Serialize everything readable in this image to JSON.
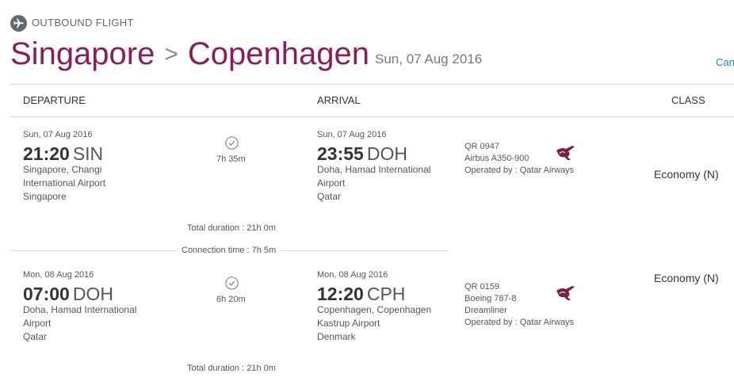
{
  "header": {
    "section_label": "OUTBOUND FLIGHT",
    "origin": "Singapore",
    "separator": ">",
    "destination": "Copenhagen",
    "date": "Sun, 07 Aug 2016",
    "cancel_link": "Canc"
  },
  "columns": {
    "departure": "DEPARTURE",
    "arrival": "ARRIVAL",
    "class": "CLASS"
  },
  "segments": [
    {
      "dep_date": "Sun, 07 Aug 2016",
      "dep_time": "21:20",
      "dep_code": "SIN",
      "dep_place": [
        "Singapore, Changi",
        "International Airport",
        "Singapore"
      ],
      "duration": "7h 35m",
      "arr_date": "Sun, 07 Aug 2016",
      "arr_time": "23:55",
      "arr_code": "DOH",
      "arr_place": [
        "Doha, Hamad International",
        "Airport",
        "Qatar"
      ],
      "flight_lines": [
        "QR 0947",
        "Airbus A350-900",
        "Operated by : Qatar Airways"
      ],
      "class": "Economy (N)",
      "total_duration": "Total duration : 21h 0m"
    },
    {
      "dep_date": "Mon, 08 Aug 2016",
      "dep_time": "07:00",
      "dep_code": "DOH",
      "dep_place": [
        "Doha, Hamad International",
        "Airport",
        "Qatar"
      ],
      "duration": "6h 20m",
      "arr_date": "Mon, 08 Aug 2016",
      "arr_time": "12:20",
      "arr_code": "CPH",
      "arr_place": [
        "Copenhagen, Copenhagen",
        "Kastrup Airport",
        "Denmark"
      ],
      "flight_lines": [
        "QR 0159",
        "Boeing 787-8",
        "Dreamliner",
        "Operated by : Qatar Airways"
      ],
      "class": "Economy (N)",
      "total_duration": "Total duration : 21h 0m"
    }
  ],
  "connection": "Connection time : 7h 5m",
  "icons": {
    "section": "airplane-icon",
    "duration": "clock-icon",
    "airline": "qatar-airways-logo"
  },
  "colors": {
    "route": "#8b1d5a",
    "link": "#1a8fc6",
    "logo": "#7a1e4a"
  }
}
